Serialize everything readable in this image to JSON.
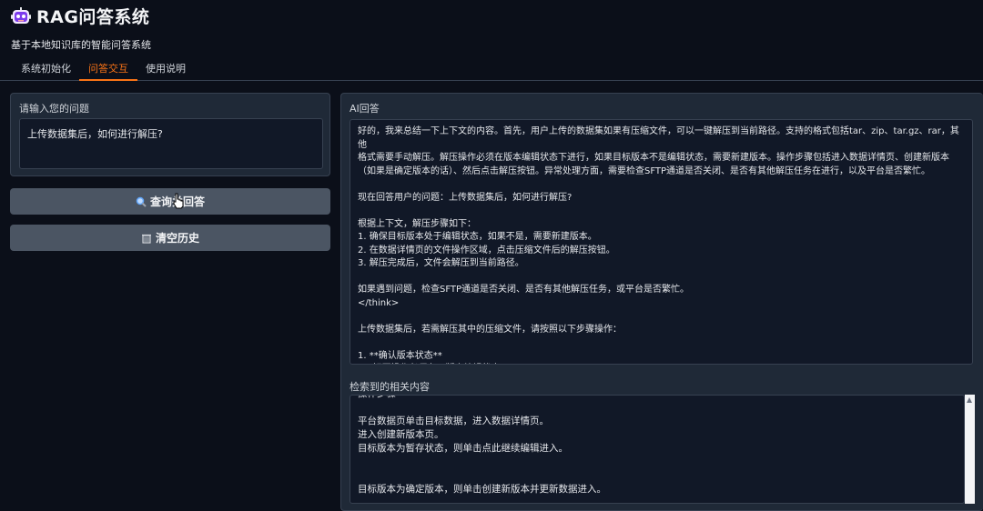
{
  "app": {
    "title": "RAG问答系统",
    "subtitle": "基于本地知识库的智能问答系统",
    "logo_icon": "robot-icon"
  },
  "tabs": [
    {
      "label": "系统初始化",
      "active": false
    },
    {
      "label": "问答交互",
      "active": true
    },
    {
      "label": "使用说明",
      "active": false
    }
  ],
  "question": {
    "label": "请输入您的问题",
    "value": "上传数据集后，如何进行解压?"
  },
  "buttons": {
    "query_label": "查询并回答",
    "query_icon": "magnifier-icon",
    "clear_label": "清空历史",
    "clear_icon": "trash-icon"
  },
  "answer": {
    "label": "AI回答",
    "lines": [
      "好的，我来总结一下上下文的内容。首先，用户上传的数据集如果有压缩文件，可以一键解压到当前路径。支持的格式包括tar、zip、tar.gz、rar，其他",
      "格式需要手动解压。解压操作必须在版本编辑状态下进行，如果目标版本不是编辑状态，需要新建版本。操作步骤包括进入数据详情页、创建新版本",
      "（如果是确定版本的话）、然后点击解压按钮。异常处理方面，需要检查SFTP通道是否关闭、是否有其他解压任务在进行，以及平台是否繁忙。",
      "",
      "现在回答用户的问题：上传数据集后，如何进行解压?",
      "",
      "根据上下文，解压步骤如下：",
      "1. 确保目标版本处于编辑状态，如果不是，需要新建版本。",
      "2. 在数据详情页的文件操作区域，点击压缩文件后的解压按钮。",
      "3. 解压完成后，文件会解压到当前路径。",
      "",
      "如果遇到问题，检查SFTP通道是否关闭、是否有其他解压任务，或平台是否繁忙。",
      "</think>",
      "",
      "上传数据集后，若需解压其中的压缩文件，请按照以下步骤操作：",
      "",
      "1. **确认版本状态**",
      "   - 解压操作必须在**版本编辑状态**"
    ]
  },
  "context": {
    "label": "检索到的相关内容",
    "lines": [
      "操作步骤",
      "",
      "平台数据页单击目标数据，进入数据详情页。",
      "进入创建新版本页。",
      "目标版本为暂存状态，则单击点此继续编辑进入。",
      "",
      "",
      "目标版本为确定版本，则单击创建新版本并更新数据进入。"
    ]
  }
}
